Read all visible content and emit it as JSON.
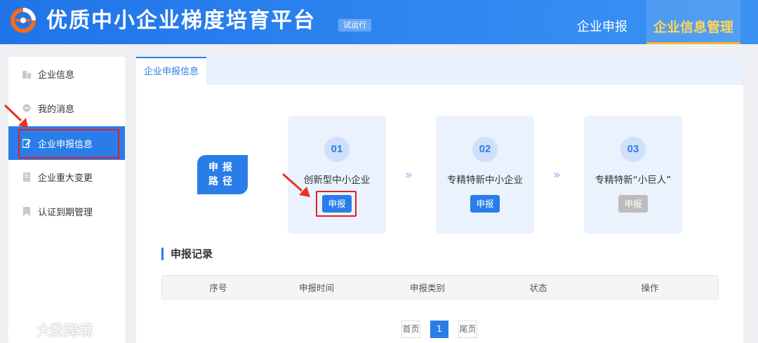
{
  "header": {
    "title": "优质中小企业梯度培育平台",
    "badge": "试运行",
    "nav": [
      {
        "label": "企业申报"
      },
      {
        "label": "企业信息管理"
      }
    ]
  },
  "sidebar": {
    "items": [
      {
        "label": "企业信息",
        "icon": "building-icon"
      },
      {
        "label": "我的消息",
        "icon": "message-icon"
      },
      {
        "label": "企业申报信息",
        "icon": "edit-icon"
      },
      {
        "label": "企业重大变更",
        "icon": "document-icon"
      },
      {
        "label": "认证到期管理",
        "icon": "bookmark-icon"
      }
    ]
  },
  "main": {
    "tab": "企业申报信息",
    "path_label_1": "申报",
    "path_label_2": "路径",
    "cards": [
      {
        "num": "01",
        "name": "创新型中小企业",
        "button": "申报"
      },
      {
        "num": "02",
        "name": "专精特新中小企业",
        "button": "申报"
      },
      {
        "num": "03",
        "name": "专精特新“小巨人”",
        "button": "申报"
      }
    ],
    "chevron": "»",
    "records_title": "申报记录",
    "table_headers": [
      "序号",
      "申报时间",
      "申报类别",
      "状态",
      "操作"
    ],
    "pagination": {
      "first": "首页",
      "current": "1",
      "last": "尾页"
    }
  },
  "watermark": "大数跨境",
  "colors": {
    "primary": "#2a7de9",
    "highlight": "#e02020",
    "accent": "#ffd65a"
  }
}
